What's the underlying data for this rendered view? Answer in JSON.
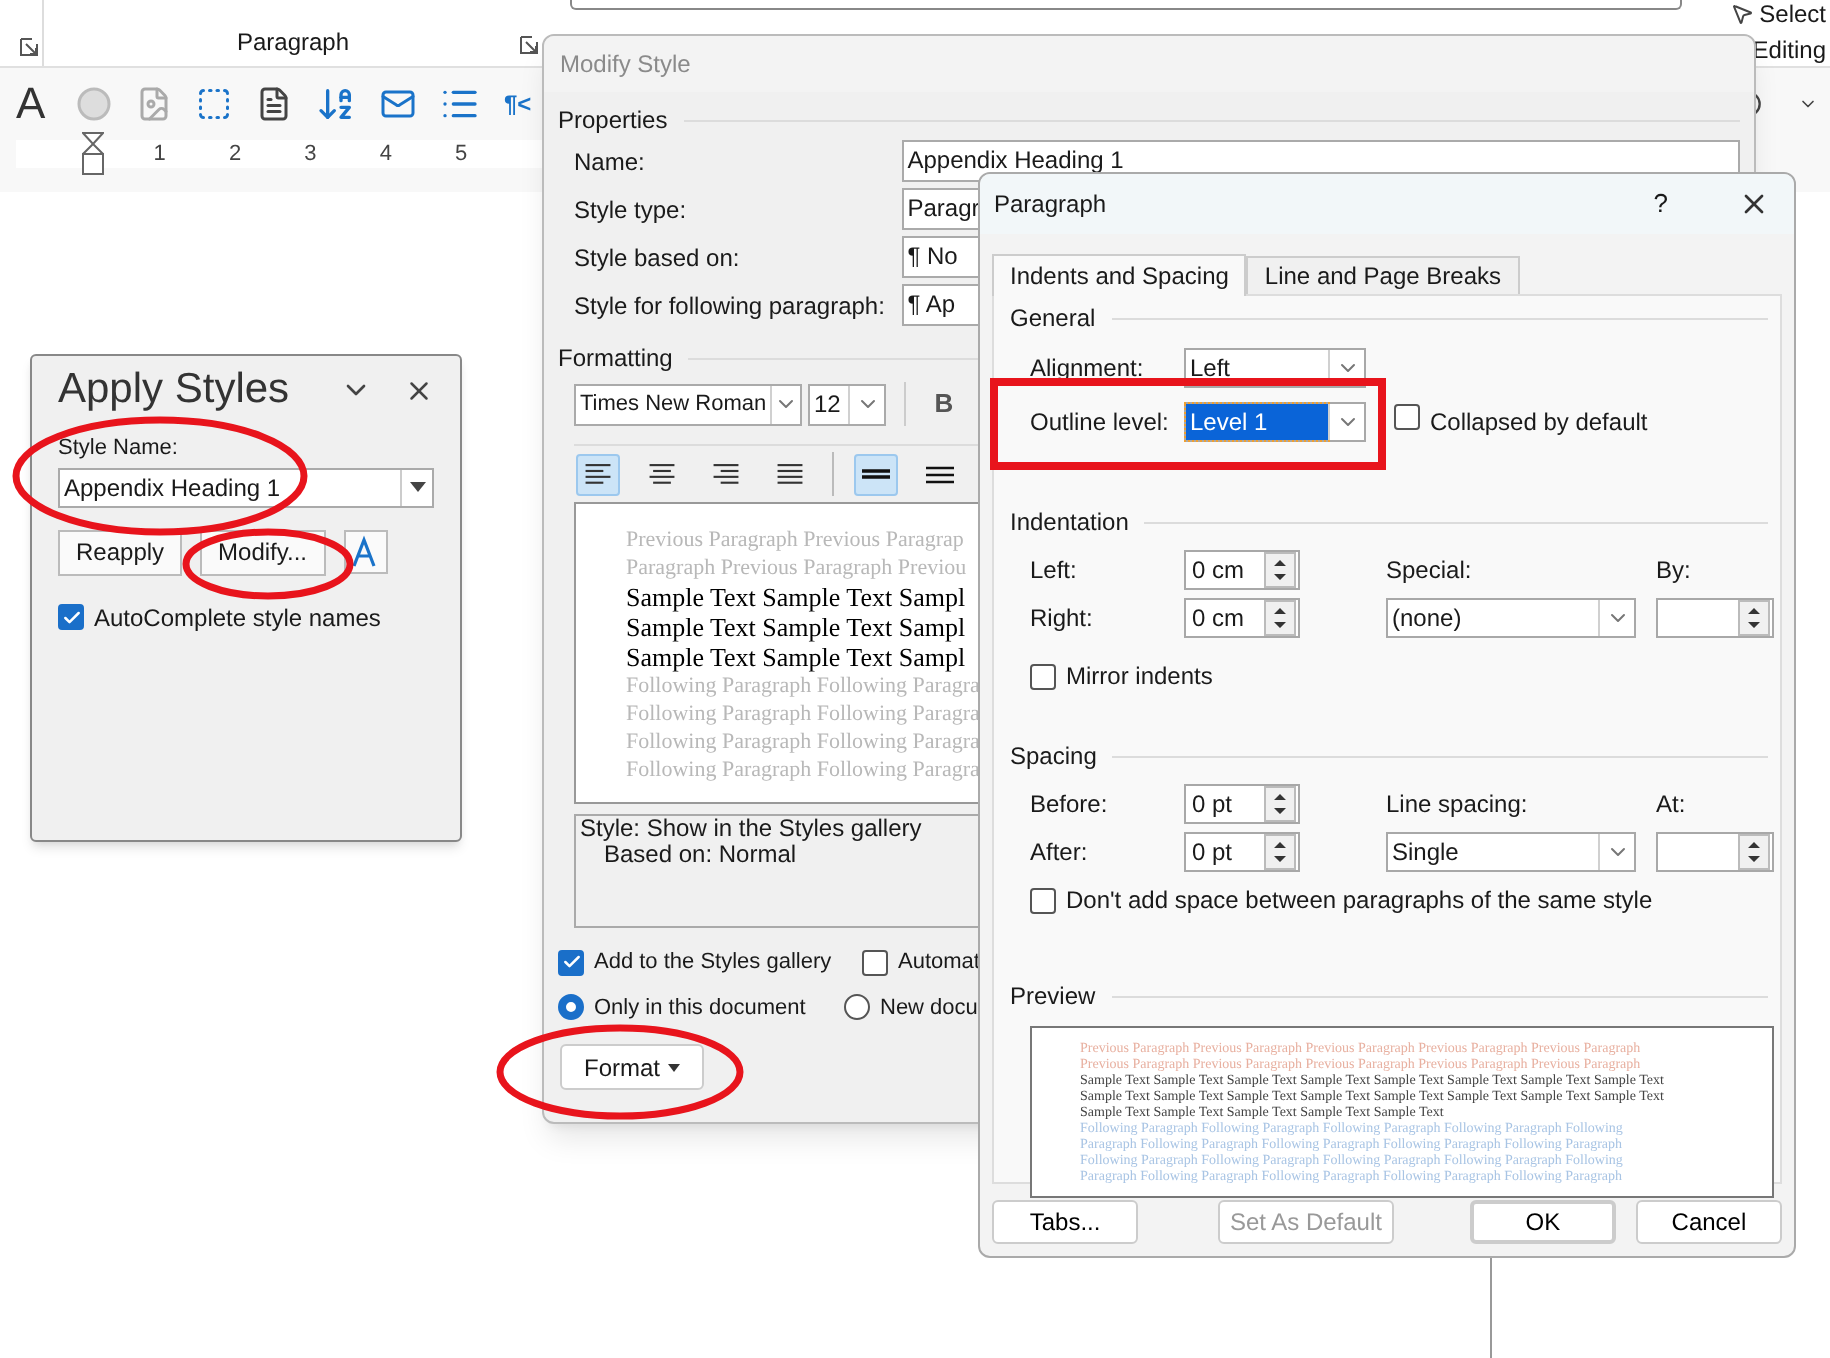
{
  "ribbon": {
    "group_label": "Paragraph",
    "font_glyph": "A",
    "pilcrow": "¶<",
    "select": "Select",
    "editing": "Editing"
  },
  "ruler": {
    "numbers": [
      "1",
      "2",
      "3",
      "4",
      "5"
    ]
  },
  "apply_styles": {
    "title": "Apply Styles",
    "style_name_label": "Style Name:",
    "style_name": "Appendix Heading 1",
    "buttons": [
      "Reapply",
      "Modify..."
    ],
    "autocomplete": {
      "label": "AutoComplete style names",
      "checked": true
    }
  },
  "modify_style": {
    "title": "Modify Style",
    "properties_header": "Properties",
    "fields": [
      {
        "label": "Name:",
        "value": "Appendix Heading 1"
      },
      {
        "label": "Style type:",
        "value": "Paragr"
      },
      {
        "label": "Style based on:",
        "value": "¶ No"
      },
      {
        "label": "Style for following paragraph:",
        "value": "¶ Ap"
      }
    ],
    "formatting_header": "Formatting",
    "font": "Times New Roman",
    "size": "12",
    "format_buttons": [
      "B"
    ],
    "alignment_buttons": [
      {
        "kind": "left",
        "selected": true
      },
      {
        "kind": "center",
        "selected": false
      },
      {
        "kind": "right",
        "selected": false
      },
      {
        "kind": "justify",
        "selected": false
      }
    ],
    "spacing_buttons": [
      {
        "kind": "single",
        "selected": true
      },
      {
        "kind": "onehalf",
        "selected": false
      }
    ],
    "preview_lines": [
      {
        "kind": "previous",
        "text": "Previous Paragraph Previous Paragrap"
      },
      {
        "kind": "previous",
        "text": "Paragraph Previous Paragraph Previou"
      },
      {
        "kind": "sample",
        "text": "Sample Text Sample Text Sampl"
      },
      {
        "kind": "sample",
        "text": "Sample Text Sample Text Sampl"
      },
      {
        "kind": "sample",
        "text": "Sample Text Sample Text Sampl"
      },
      {
        "kind": "following",
        "text": "Following Paragraph Following Paragra"
      },
      {
        "kind": "following",
        "text": "Following Paragraph Following Paragra"
      },
      {
        "kind": "following",
        "text": "Following Paragraph Following Paragra"
      },
      {
        "kind": "following",
        "text": "Following Paragraph Following Paragra"
      }
    ],
    "description": [
      "Style: Show in the Styles gallery",
      "Based on: Normal"
    ],
    "options": [
      {
        "kind": "checkbox",
        "label": "Add to the Styles gallery",
        "checked": true
      },
      {
        "kind": "checkbox",
        "label": "Automat",
        "checked": false
      },
      {
        "kind": "radio",
        "label": "Only in this document",
        "selected": true
      },
      {
        "kind": "radio",
        "label": "New docu",
        "selected": false
      }
    ],
    "format_button": "Format"
  },
  "paragraph": {
    "title": "Paragraph",
    "help": "?",
    "tabs": [
      {
        "label": "Indents and Spacing",
        "selected": true
      },
      {
        "label": "Line and Page Breaks",
        "selected": false
      }
    ],
    "general": {
      "header": "General",
      "alignment": {
        "label": "Alignment:",
        "value": "Left"
      },
      "outline_level": {
        "label": "Outline level:",
        "value": "Level 1",
        "selected": true
      },
      "collapsed": {
        "label": "Collapsed by default",
        "checked": false
      }
    },
    "indentation": {
      "header": "Indentation",
      "left": {
        "label": "Left:",
        "value": "0 cm"
      },
      "right": {
        "label": "Right:",
        "value": "0 cm"
      },
      "special": {
        "label": "Special:",
        "value": "(none)"
      },
      "by": {
        "label": "By:"
      },
      "mirror": {
        "label": "Mirror indents",
        "checked": false
      }
    },
    "spacing": {
      "header": "Spacing",
      "before": {
        "label": "Before:",
        "value": "0 pt"
      },
      "after": {
        "label": "After:",
        "value": "0 pt"
      },
      "line_spacing": {
        "label": "Line spacing:",
        "value": "Single"
      },
      "at": {
        "label": "At:"
      },
      "dont_add": {
        "label": "Don't add space between paragraphs of the same style",
        "checked": false
      }
    },
    "preview": {
      "header": "Preview",
      "lines": [
        {
          "kind": "previous",
          "text": "Previous Paragraph Previous Paragraph Previous Paragraph Previous Paragraph Previous Paragraph"
        },
        {
          "kind": "previous",
          "text": "Previous Paragraph Previous Paragraph Previous Paragraph Previous Paragraph Previous Paragraph"
        },
        {
          "kind": "sample",
          "text": "Sample Text Sample Text Sample Text Sample Text Sample Text Sample Text Sample Text Sample Text"
        },
        {
          "kind": "sample",
          "text": "Sample Text Sample Text Sample Text Sample Text Sample Text Sample Text Sample Text Sample Text"
        },
        {
          "kind": "sample",
          "text": "Sample Text Sample Text Sample Text Sample Text Sample Text"
        },
        {
          "kind": "following",
          "text": "Following Paragraph Following Paragraph Following Paragraph Following Paragraph Following"
        },
        {
          "kind": "following",
          "text": "Paragraph Following Paragraph Following Paragraph Following Paragraph Following Paragraph"
        },
        {
          "kind": "following",
          "text": "Following Paragraph Following Paragraph Following Paragraph Following Paragraph Following"
        },
        {
          "kind": "following",
          "text": "Paragraph Following Paragraph Following Paragraph Following Paragraph Following Paragraph"
        }
      ]
    },
    "buttons": [
      {
        "label": "Tabs...",
        "disabled": false,
        "default": false
      },
      {
        "label": "Set As Default",
        "disabled": true,
        "default": false
      },
      {
        "label": "OK",
        "disabled": false,
        "default": true
      },
      {
        "label": "Cancel",
        "disabled": false,
        "default": false
      }
    ]
  }
}
